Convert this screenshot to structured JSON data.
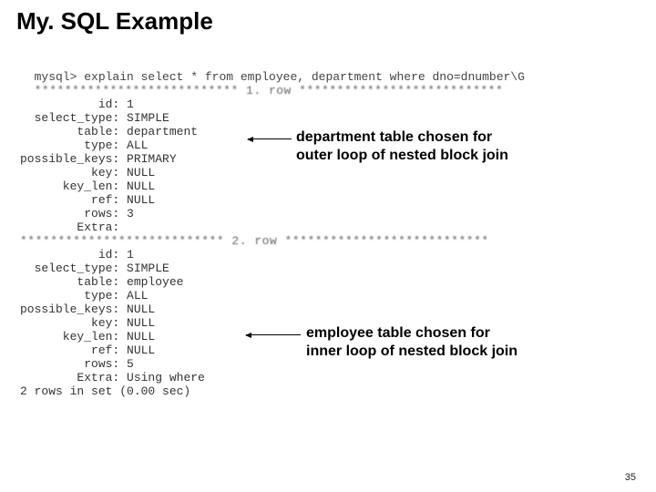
{
  "title": "My. SQL Example",
  "query_line": "mysql> explain select * from employee, department where dno=dnumber\\G",
  "row_header_1": "*************************** 1. row ***************************",
  "row1": {
    "id": "1",
    "select_type": "SIMPLE",
    "table": "department",
    "type": "ALL",
    "possible_keys": "PRIMARY",
    "key": "NULL",
    "key_len": "NULL",
    "ref": "NULL",
    "rows": "3",
    "Extra": ""
  },
  "row_header_2": "*************************** 2. row ***************************",
  "row2": {
    "id": "1",
    "select_type": "SIMPLE",
    "table": "employee",
    "type": "ALL",
    "possible_keys": "NULL",
    "key": "NULL",
    "key_len": "NULL",
    "ref": "NULL",
    "rows": "5",
    "Extra": "Using where"
  },
  "footer_line": "2 rows in set (0.00 sec)",
  "annotation1_line1": "department table chosen for",
  "annotation1_line2": "outer loop of nested block join",
  "annotation2_line1": "employee table chosen for",
  "annotation2_line2": "inner loop of nested block join",
  "page_number": "35",
  "labels": {
    "id": "           id:",
    "select_type": "  select_type:",
    "table": "        table:",
    "type": "         type:",
    "possible_keys": "possible_keys:",
    "key": "          key:",
    "key_len": "      key_len:",
    "ref": "          ref:",
    "rows": "         rows:",
    "Extra": "        Extra:"
  }
}
